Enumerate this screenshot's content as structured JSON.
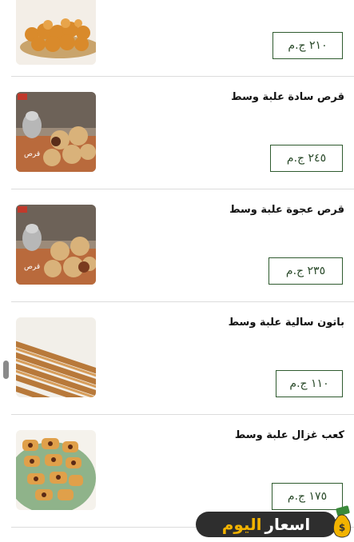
{
  "items": [
    {
      "name": "",
      "price": "٢١٠ ج.م",
      "image": "cookies-tray-image"
    },
    {
      "name": "قرص سادة علبة وسط",
      "price": "٢٤٥ ج.م",
      "image": "plain-qurs-image"
    },
    {
      "name": "قرص عجوة علبة وسط",
      "price": "٢٣٥ ج.م",
      "image": "date-qurs-image"
    },
    {
      "name": "باتون سالية علبة وسط",
      "price": "١١٠ ج.م",
      "image": "baton-sale-image"
    },
    {
      "name": "كعب غزال علبة وسط",
      "price": "١٧٥ ج.م",
      "image": "kaab-ghazal-image"
    }
  ],
  "logo": {
    "word1": "اسعار",
    "word2": "اليوم"
  },
  "colors": {
    "price_border": "#2f5b2f",
    "price_text": "#2a4a2a",
    "divider": "#dcdcdc",
    "logo_accent": "#f2b300"
  }
}
